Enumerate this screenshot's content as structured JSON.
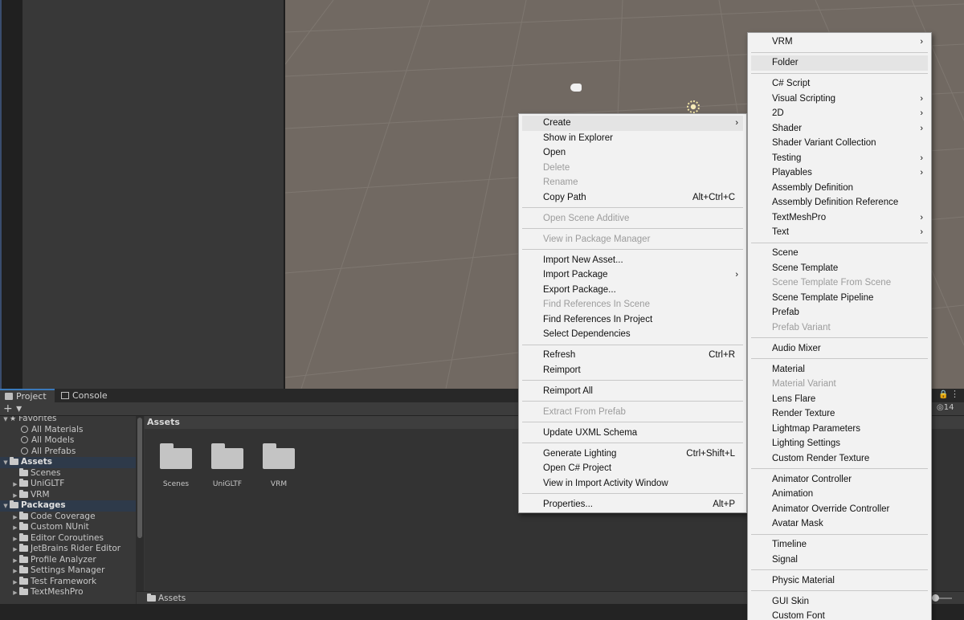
{
  "project_window": {
    "tabs": [
      {
        "label": "Project",
        "icon": "folder-icon"
      },
      {
        "label": "Console",
        "icon": "console-icon"
      }
    ],
    "toolbar": {
      "add_label": "+ ▾",
      "visibility_count": "14"
    },
    "tree": [
      {
        "label": "Favorites",
        "kind": "header",
        "icon": "star-icon"
      },
      {
        "label": "All Materials",
        "kind": "search"
      },
      {
        "label": "All Models",
        "kind": "search"
      },
      {
        "label": "All Prefabs",
        "kind": "search"
      },
      {
        "label": "Assets",
        "kind": "header-folder"
      },
      {
        "label": "Scenes",
        "kind": "folder",
        "expandable": false
      },
      {
        "label": "UniGLTF",
        "kind": "folder",
        "expandable": true
      },
      {
        "label": "VRM",
        "kind": "folder",
        "expandable": true
      },
      {
        "label": "Packages",
        "kind": "header-folder"
      },
      {
        "label": "Code Coverage",
        "kind": "folder",
        "expandable": true
      },
      {
        "label": "Custom NUnit",
        "kind": "folder",
        "expandable": true
      },
      {
        "label": "Editor Coroutines",
        "kind": "folder",
        "expandable": true
      },
      {
        "label": "JetBrains Rider Editor",
        "kind": "folder",
        "expandable": true
      },
      {
        "label": "Profile Analyzer",
        "kind": "folder",
        "expandable": true
      },
      {
        "label": "Settings Manager",
        "kind": "folder",
        "expandable": true
      },
      {
        "label": "Test Framework",
        "kind": "folder",
        "expandable": true
      },
      {
        "label": "TextMeshPro",
        "kind": "folder",
        "expandable": true
      }
    ],
    "grid_header": "Assets",
    "assets": [
      "Scenes",
      "UniGLTF",
      "VRM"
    ],
    "bottom_path": "Assets"
  },
  "context_menu": {
    "groups": [
      [
        {
          "label": "Create",
          "submenu": true,
          "highlighted": true
        },
        {
          "label": "Show in Explorer"
        },
        {
          "label": "Open"
        },
        {
          "label": "Delete",
          "disabled": true
        },
        {
          "label": "Rename",
          "disabled": true
        },
        {
          "label": "Copy Path",
          "shortcut": "Alt+Ctrl+C"
        }
      ],
      [
        {
          "label": "Open Scene Additive",
          "disabled": true
        }
      ],
      [
        {
          "label": "View in Package Manager",
          "disabled": true
        }
      ],
      [
        {
          "label": "Import New Asset..."
        },
        {
          "label": "Import Package",
          "submenu": true
        },
        {
          "label": "Export Package..."
        },
        {
          "label": "Find References In Scene",
          "disabled": true
        },
        {
          "label": "Find References In Project"
        },
        {
          "label": "Select Dependencies"
        }
      ],
      [
        {
          "label": "Refresh",
          "shortcut": "Ctrl+R"
        },
        {
          "label": "Reimport"
        }
      ],
      [
        {
          "label": "Reimport All"
        }
      ],
      [
        {
          "label": "Extract From Prefab",
          "disabled": true
        }
      ],
      [
        {
          "label": "Update UXML Schema"
        }
      ],
      [
        {
          "label": "Generate Lighting",
          "shortcut": "Ctrl+Shift+L"
        },
        {
          "label": "Open C# Project"
        },
        {
          "label": "View in Import Activity Window"
        }
      ],
      [
        {
          "label": "Properties...",
          "shortcut": "Alt+P"
        }
      ]
    ]
  },
  "create_submenu": {
    "groups": [
      [
        {
          "label": "VRM",
          "submenu": true
        }
      ],
      [
        {
          "label": "Folder",
          "highlighted": true
        }
      ],
      [
        {
          "label": "C# Script"
        },
        {
          "label": "Visual Scripting",
          "submenu": true
        },
        {
          "label": "2D",
          "submenu": true
        },
        {
          "label": "Shader",
          "submenu": true
        },
        {
          "label": "Shader Variant Collection"
        },
        {
          "label": "Testing",
          "submenu": true
        },
        {
          "label": "Playables",
          "submenu": true
        },
        {
          "label": "Assembly Definition"
        },
        {
          "label": "Assembly Definition Reference"
        },
        {
          "label": "TextMeshPro",
          "submenu": true
        },
        {
          "label": "Text",
          "submenu": true
        }
      ],
      [
        {
          "label": "Scene"
        },
        {
          "label": "Scene Template"
        },
        {
          "label": "Scene Template From Scene",
          "disabled": true
        },
        {
          "label": "Scene Template Pipeline"
        },
        {
          "label": "Prefab"
        },
        {
          "label": "Prefab Variant",
          "disabled": true
        }
      ],
      [
        {
          "label": "Audio Mixer"
        }
      ],
      [
        {
          "label": "Material"
        },
        {
          "label": "Material Variant",
          "disabled": true
        },
        {
          "label": "Lens Flare"
        },
        {
          "label": "Render Texture"
        },
        {
          "label": "Lightmap Parameters"
        },
        {
          "label": "Lighting Settings"
        },
        {
          "label": "Custom Render Texture"
        }
      ],
      [
        {
          "label": "Animator Controller"
        },
        {
          "label": "Animation"
        },
        {
          "label": "Animator Override Controller"
        },
        {
          "label": "Avatar Mask"
        }
      ],
      [
        {
          "label": "Timeline"
        },
        {
          "label": "Signal"
        }
      ],
      [
        {
          "label": "Physic Material"
        }
      ],
      [
        {
          "label": "GUI Skin"
        },
        {
          "label": "Custom Font"
        }
      ]
    ]
  },
  "colors": {
    "scene_bg": "#716962",
    "menu_bg": "#f2f2f2",
    "menu_highlight": "#e4e4e4",
    "disabled_text": "#9c9c9c",
    "accent": "#3a79bb"
  }
}
